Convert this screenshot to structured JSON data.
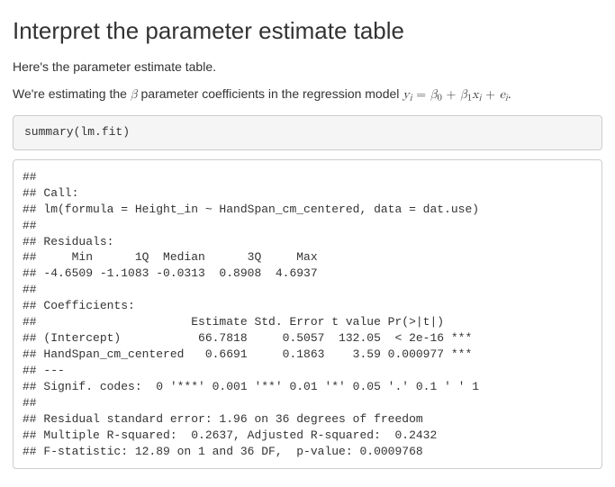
{
  "heading": "Interpret the parameter estimate table",
  "intro": "Here's the parameter estimate table.",
  "estimating_prefix": "We're estimating the ",
  "estimating_mid": " parameter coefficients in the regression model ",
  "estimating_suffix": ".",
  "math": {
    "beta": "β",
    "lhs": "y",
    "lhs_sub": "i",
    "eq": " = ",
    "b0": "β",
    "b0_sub": "0",
    "plus1": " + ",
    "b1": "β",
    "b1_sub": "1",
    "x": "x",
    "x_sub": "i",
    "plus2": " + ",
    "e": "e",
    "e_sub": "i"
  },
  "code_input": "summary(lm.fit)",
  "code_output": "## \n## Call:\n## lm(formula = Height_in ~ HandSpan_cm_centered, data = dat.use)\n## \n## Residuals:\n##     Min      1Q  Median      3Q     Max \n## -4.6509 -1.1083 -0.0313  0.8908  4.6937 \n## \n## Coefficients:\n##                      Estimate Std. Error t value Pr(>|t|)    \n## (Intercept)           66.7818     0.5057  132.05  < 2e-16 ***\n## HandSpan_cm_centered   0.6691     0.1863    3.59 0.000977 ***\n## ---\n## Signif. codes:  0 '***' 0.001 '**' 0.01 '*' 0.05 '.' 0.1 ' ' 1\n## \n## Residual standard error: 1.96 on 36 degrees of freedom\n## Multiple R-squared:  0.2637, Adjusted R-squared:  0.2432 \n## F-statistic: 12.89 on 1 and 36 DF,  p-value: 0.0009768",
  "chart_data": {
    "type": "table",
    "title": "Coefficients",
    "columns": [
      "",
      "Estimate",
      "Std. Error",
      "t value",
      "Pr(>|t|)",
      "signif"
    ],
    "rows": [
      [
        "(Intercept)",
        66.7818,
        0.5057,
        132.05,
        "< 2e-16",
        "***"
      ],
      [
        "HandSpan_cm_centered",
        0.6691,
        0.1863,
        3.59,
        0.000977,
        "***"
      ]
    ],
    "residuals": {
      "Min": -4.6509,
      "1Q": -1.1083,
      "Median": -0.0313,
      "3Q": 0.8908,
      "Max": 4.6937
    },
    "residual_std_error": 1.96,
    "df": 36,
    "r_squared": 0.2637,
    "adj_r_squared": 0.2432,
    "f_statistic": 12.89,
    "f_df": [
      1,
      36
    ],
    "p_value": 0.0009768
  }
}
